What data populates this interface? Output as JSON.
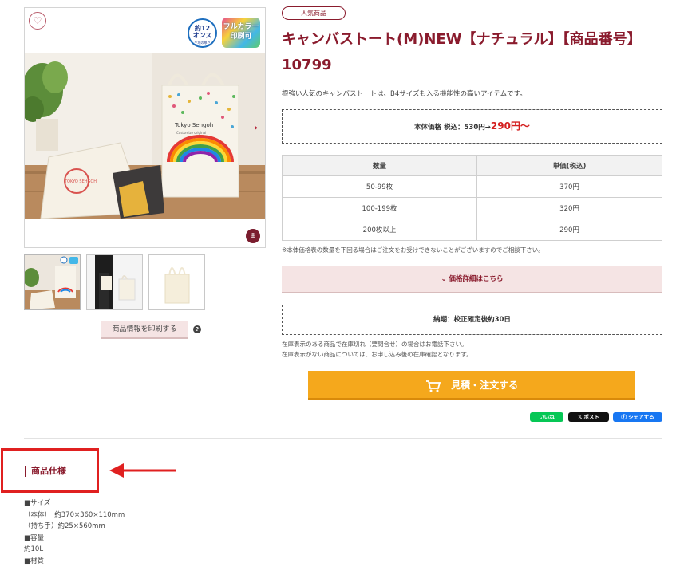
{
  "gallery": {
    "ounce_badge": {
      "line1": "約12",
      "line2": "オンス",
      "line3": "生地の厚さ"
    },
    "fullcolor_badge": {
      "line1": "フルカラー",
      "line2": "印刷可"
    },
    "bag_print": {
      "brand": "Tokyo Sehgoh",
      "sub": "Customize original",
      "mark": "TOKYO SEHGOH"
    },
    "print_button": "商品情報を印刷する"
  },
  "product": {
    "tag": "人気商品",
    "title": "キャンバストート(M)NEW【ナチュラル】【商品番号】10799",
    "description": "根強い人気のキャンバストートは、B4サイズも入る機能性の高いアイテムです。",
    "price_label": "本体価格 税込：530円→",
    "price_value": "290円〜",
    "table": {
      "headers": [
        "数量",
        "単価(税込)"
      ],
      "rows": [
        [
          "50-99枚",
          "370円"
        ],
        [
          "100-199枚",
          "320円"
        ],
        [
          "200枚以上",
          "290円"
        ]
      ]
    },
    "table_note": "※本体価格表の数量を下回る場合はご注文をお受けできないことがございますのでご相談下さい。",
    "price_detail_button": "価格詳細はこちら",
    "delivery": "納期：校正確定後約30日",
    "stock_note_1": "在庫表示のある商品で在庫切れ（要問合せ）の場合はお電話下さい。",
    "stock_note_2": "在庫表示がない商品については、お申し込み後の在庫確認となります。",
    "order_button": "見積・注文する"
  },
  "share": {
    "line": "いいね",
    "x": "ポスト",
    "facebook": "シェアする"
  },
  "spec": {
    "heading": "商品仕様",
    "lines": [
      "■サイズ",
      "（本体）　約370×360×110mm",
      "（持ち手）約25×560mm",
      "■容量",
      "約10L",
      "■材質"
    ]
  },
  "colors": {
    "brand": "#8a1b2d",
    "accent_orange": "#f5a81c",
    "price_red": "#d42020",
    "highlight_red": "#e02020"
  }
}
